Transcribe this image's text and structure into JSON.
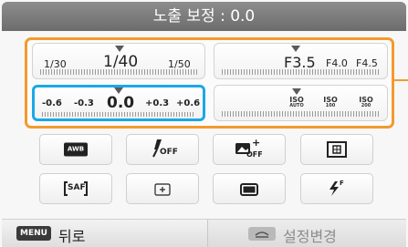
{
  "title": "노출 보정 : 0.0",
  "shutter": {
    "left": "1/30",
    "current": "1/40",
    "right": "1/50"
  },
  "aperture": {
    "current": "F3.5",
    "next1": "F4.0",
    "next2": "F4.5"
  },
  "ev": {
    "values": [
      "-0.6",
      "-0.3",
      "0.0",
      "+0.3",
      "+0.6"
    ],
    "selected_index": 2
  },
  "iso": [
    {
      "label": "ISO",
      "value": "AUTO"
    },
    {
      "label": "ISO",
      "value": "100"
    },
    {
      "label": "ISO",
      "value": "200"
    }
  ],
  "buttons": [
    {
      "name": "awb-button",
      "icon": "awb-icon",
      "text": "AWB"
    },
    {
      "name": "flash-off-button",
      "icon": "flash-off-icon",
      "text": "OFF"
    },
    {
      "name": "smart-filter-off-button",
      "icon": "smart-filter-off-icon",
      "text": "OFF"
    },
    {
      "name": "metering-button",
      "icon": "multi-metering-icon",
      "text": ""
    },
    {
      "name": "af-mode-button",
      "icon": "saf-icon",
      "text": "SAF"
    },
    {
      "name": "af-area-button",
      "icon": "center-af-icon",
      "text": ""
    },
    {
      "name": "aspect-ratio-button",
      "icon": "aspect-ratio-icon",
      "text": ""
    },
    {
      "name": "flash-mode-button",
      "icon": "flash-fill-icon",
      "text": "F"
    }
  ],
  "bottom": {
    "menu_key": "MENU",
    "back_label": "뒤로",
    "settings_label": "설정변경"
  },
  "colors": {
    "selection": "#1ba8e6",
    "highlight_group": "#f39a2e",
    "title_bar": "#7b7b7b"
  }
}
